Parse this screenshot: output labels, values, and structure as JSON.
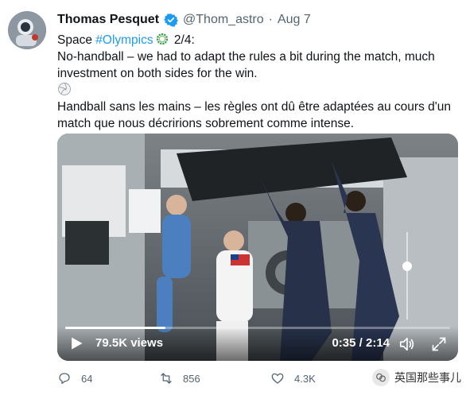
{
  "author": {
    "name": "Thomas Pesquet",
    "handle": "@Thom_astro",
    "separator": "·",
    "date": "Aug 7"
  },
  "tweet": {
    "line1_prefix": "Space ",
    "line1_hashtag": "#Olympics",
    "line1_suffix": " 2/4:",
    "english_line1": "No-handball – we had to adapt the rules a bit during the match, much",
    "english_line2": "investment on both sides for the win.",
    "french_line1": "Handball sans les mains – les règles ont dû être adaptées au cours d'un",
    "french_line2": "match que nous décririons sobrement comme intense."
  },
  "video": {
    "views": "79.5K views",
    "time": "0:35 / 2:14",
    "progress_fraction": 0.26,
    "volume_fraction": 0.62
  },
  "actions": {
    "replies": "64",
    "retweets": "856",
    "likes": "4.3K"
  },
  "watermark": {
    "text": "英国那些事儿"
  },
  "colors": {
    "accent": "#1d9bf0",
    "text": "#0f1419",
    "muted": "#536471"
  }
}
